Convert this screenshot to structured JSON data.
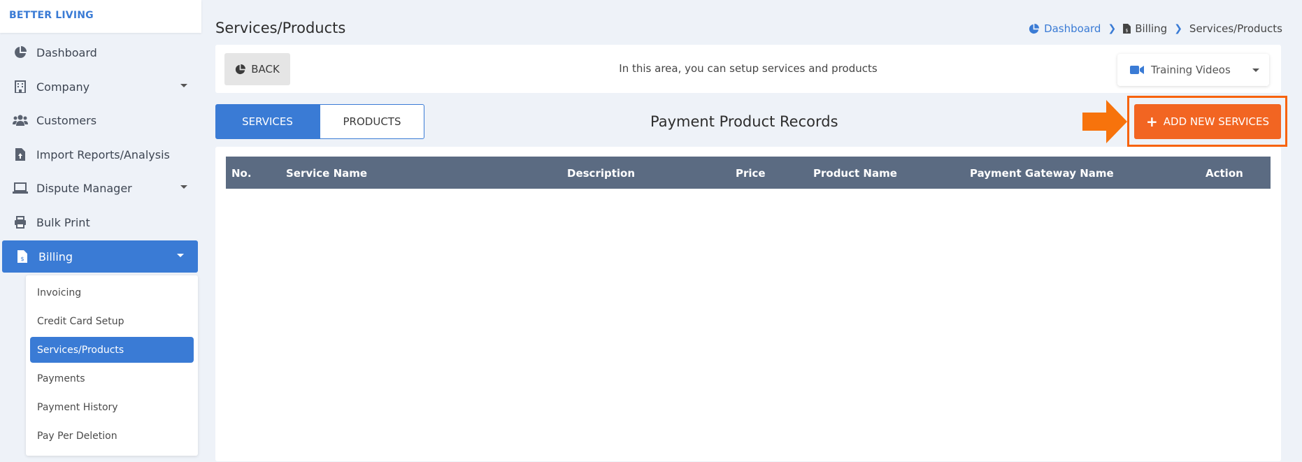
{
  "brand": "BETTER LIVING",
  "sidebar": {
    "items": [
      {
        "label": "Dashboard",
        "icon": "pie-chart-icon"
      },
      {
        "label": "Company",
        "icon": "building-icon",
        "has_caret": true
      },
      {
        "label": "Customers",
        "icon": "users-icon"
      },
      {
        "label": "Import Reports/Analysis",
        "icon": "file-import-icon"
      },
      {
        "label": "Dispute Manager",
        "icon": "laptop-icon",
        "has_caret": true
      },
      {
        "label": "Bulk Print",
        "icon": "printer-icon"
      },
      {
        "label": "Billing",
        "icon": "invoice-icon",
        "has_caret": true,
        "active": true
      }
    ],
    "submenu": [
      {
        "label": "Invoicing"
      },
      {
        "label": "Credit Card Setup"
      },
      {
        "label": "Services/Products",
        "active": true
      },
      {
        "label": "Payments"
      },
      {
        "label": "Payment History"
      },
      {
        "label": "Pay Per Deletion"
      }
    ]
  },
  "page_title": "Services/Products",
  "breadcrumb": {
    "dashboard": "Dashboard",
    "billing": "Billing",
    "current": "Services/Products"
  },
  "infobar": {
    "back_label": "BACK",
    "info_text": "In this area, you can setup services and products",
    "training_label": "Training Videos"
  },
  "tabs": {
    "services": "SERVICES",
    "products": "PRODUCTS"
  },
  "section_title": "Payment Product Records",
  "add_button_label": "ADD NEW SERVICES",
  "table": {
    "headers": [
      "No.",
      "Service Name",
      "Description",
      "Price",
      "Product Name",
      "Payment Gateway Name",
      "Action"
    ]
  },
  "colors": {
    "accent": "#3a7bd5",
    "orange": "#f26522",
    "table_header": "#5b6b82"
  }
}
